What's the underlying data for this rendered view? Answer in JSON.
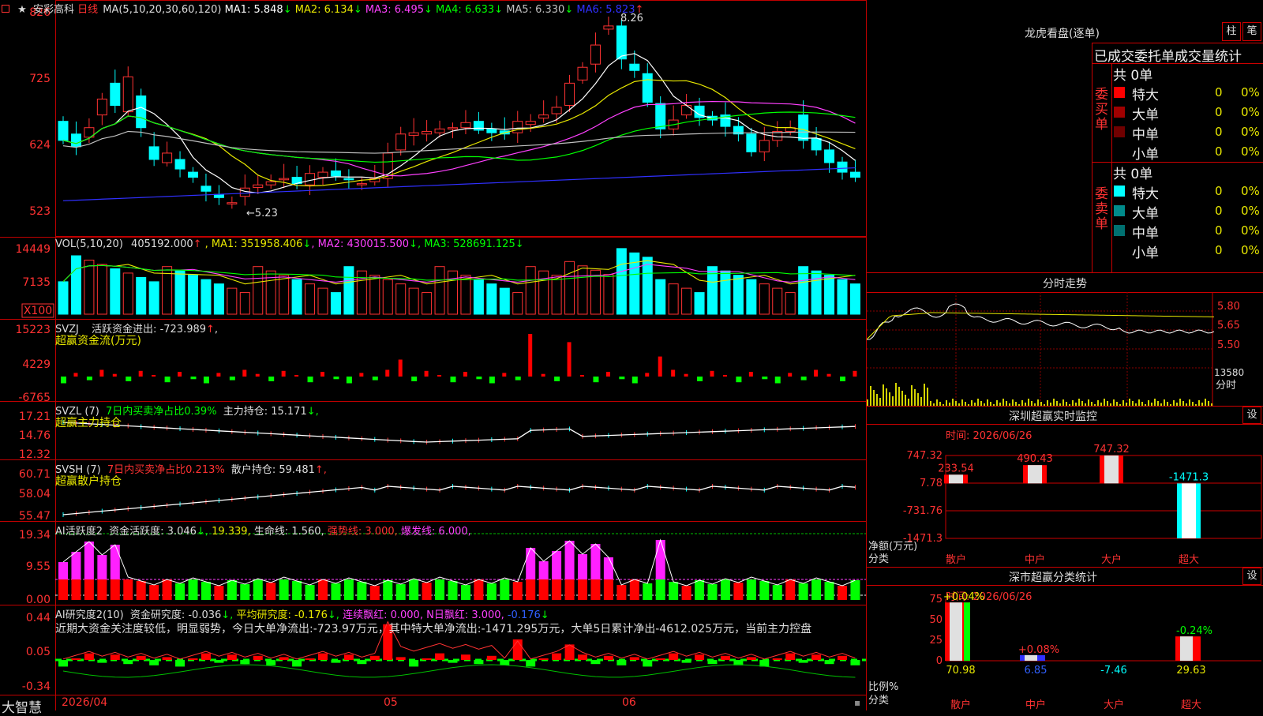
{
  "stock": {
    "name": "安彩高科",
    "period": "日线"
  },
  "main": {
    "ma_params": "MA(5,10,20,30,60,120)",
    "ma": [
      {
        "label": "MA1:",
        "value": "5.848",
        "arrow": "↓",
        "color": "#ffffff"
      },
      {
        "label": "MA2:",
        "value": "6.134",
        "arrow": "↓",
        "color": "#e8e800"
      },
      {
        "label": "MA3:",
        "value": "6.495",
        "arrow": "↓",
        "color": "#ff40ff"
      },
      {
        "label": "MA4:",
        "value": "6.633",
        "arrow": "↓",
        "color": "#00ff00"
      },
      {
        "label": "MA5:",
        "value": "6.330",
        "arrow": "↓",
        "color": "#c0c0c0"
      },
      {
        "label": "MA6:",
        "value": "5.823",
        "arrow": "↑",
        "color": "#3030ff"
      }
    ],
    "y_labels": [
      "826",
      "725",
      "624",
      "523"
    ],
    "high_label": "8.26",
    "low_label": "←5.23"
  },
  "vol": {
    "params": "VOL(5,10,20)",
    "value": "405192.000",
    "up": "↑",
    "ma": [
      {
        "label": "MA1:",
        "value": "351958.406",
        "arrow": "↓",
        "color": "#e8e800"
      },
      {
        "label": "MA2:",
        "value": "430015.500",
        "arrow": "↓",
        "color": "#ff40ff"
      },
      {
        "label": "MA3:",
        "value": "528691.125",
        "arrow": "↓",
        "color": "#00ff00"
      }
    ],
    "y_labels": [
      "14449",
      "7135"
    ],
    "unit": "X100"
  },
  "svzj": {
    "code": "SVZJ",
    "label": "活跃资金进出:",
    "value": "-723.989",
    "arrow": "↑",
    "subtitle": "超赢资金流(万元)",
    "y_labels": [
      "15223",
      "4229",
      "-6765"
    ]
  },
  "svzl": {
    "code": "SVZL (7)",
    "label": "7日内买卖净占比0.39%",
    "label2": "主力持仓:",
    "value": "15.171",
    "arrow": "↓,",
    "subtitle": "超赢主力持仓",
    "y_labels": [
      "17.21",
      "14.76",
      "12.32"
    ]
  },
  "svsh": {
    "code": "SVSH (7)",
    "label": "7日内买卖净占比0.213%",
    "label2": "散户持仓:",
    "value": "59.481",
    "arrow": "↑,",
    "subtitle": "超赢散户持仓",
    "y_labels": [
      "60.71",
      "58.04",
      "55.47"
    ]
  },
  "ai1": {
    "title": "AI活跃度2",
    "label1": "资金活跃度:",
    "value1": "3.046",
    "arrow1": "↓,",
    "value2": "19.339,",
    "label3": "生命线:",
    "value3": "1.560,",
    "label4": "强势线:",
    "value4": "3.000,",
    "label5": "爆发线:",
    "value5": "6.000,",
    "y_labels": [
      "19.34",
      "9.55",
      "0.00"
    ]
  },
  "ai2": {
    "title": "AI研究度2(10)",
    "label1": "资金研究度:",
    "value1": "-0.036",
    "arrow1": "↓,",
    "label2": "平均研究度:",
    "value2": "-0.176",
    "arrow2": "↓,",
    "label3": "连续飘红:",
    "value3": "0.000,",
    "label4": "N日飘红:",
    "value4": "3.000,",
    "value5": "-0.176",
    "arrow5": "↓",
    "comment": "近期大资金关注度较低，明显弱势，今日大单净流出:-723.97万元，其中特大单净流出:-1471.295万元，大单5日累计净出-4612.025万元，当前主力控盘",
    "y_labels": [
      "0.44",
      "0.05",
      "-0.34"
    ]
  },
  "xaxis": {
    "brand": "大智慧",
    "labels": [
      "2026/04",
      "05",
      "06"
    ]
  },
  "right": {
    "lhb": {
      "title": "龙虎看盘(逐单)",
      "btn1": "柱",
      "btn2": "笔",
      "subtitle": "已成交委托单成交量统计",
      "buy": {
        "side": "委买单",
        "total": "共 0单",
        "rows": [
          {
            "label": "特大",
            "count": "0",
            "pct": "0%",
            "color": "#ff0000"
          },
          {
            "label": "大单",
            "count": "0",
            "pct": "0%",
            "color": "#a00000"
          },
          {
            "label": "中单",
            "count": "0",
            "pct": "0%",
            "color": "#700000"
          },
          {
            "label": "小单",
            "count": "0",
            "pct": "0%",
            "color": ""
          }
        ]
      },
      "sell": {
        "side": "委卖单",
        "total": "共 0单",
        "rows": [
          {
            "label": "特大",
            "count": "0",
            "pct": "0%",
            "color": "#00ffff"
          },
          {
            "label": "大单",
            "count": "0",
            "pct": "0%",
            "color": "#008b8b"
          },
          {
            "label": "中单",
            "count": "0",
            "pct": "0%",
            "color": "#007070"
          },
          {
            "label": "小单",
            "count": "0",
            "pct": "0%",
            "color": ""
          }
        ]
      }
    },
    "fenshi": {
      "title": "分时走势",
      "y_labels": [
        "5.80",
        "5.65",
        "5.50"
      ],
      "vol_label": "13580",
      "unit": "分时"
    },
    "sz_monitor": {
      "title": "深圳超赢实时监控",
      "btn": "设",
      "time": "时间: 2026/06/26",
      "y_labels": [
        "747.32",
        "7.78",
        "-731.76",
        "-1471.3"
      ],
      "axis_title": "净额(万元)",
      "axis_sub": "分类",
      "values": [
        {
          "label": "233.54",
          "value": 233.54
        },
        {
          "label": "490.43",
          "value": 490.43
        },
        {
          "label": "747.32",
          "value": 747.32
        },
        {
          "label": "-1471.3",
          "value": -1471.3
        }
      ],
      "categories": [
        "散户",
        "中户",
        "大户",
        "超大"
      ]
    },
    "sz_class": {
      "title": "深市超赢分类统计",
      "btn": "设",
      "time": "时间: 2026/06/26",
      "y_labels": [
        "75",
        "50",
        "25",
        "0"
      ],
      "axis_title": "比例%",
      "axis_sub": "分类",
      "bars": [
        {
          "top_label": "+0.04%",
          "value": 70.98,
          "bottom": "70.98"
        },
        {
          "top_label": "+0.08%",
          "value": 6.85,
          "bottom": "6.85"
        },
        {
          "top_label": "",
          "value": 0,
          "bottom": "-7.46"
        },
        {
          "top_label": "-0.24%",
          "value": 29.63,
          "bottom": "29.63"
        }
      ],
      "categories": [
        "散户",
        "中户",
        "大户",
        "超大"
      ]
    }
  }
}
